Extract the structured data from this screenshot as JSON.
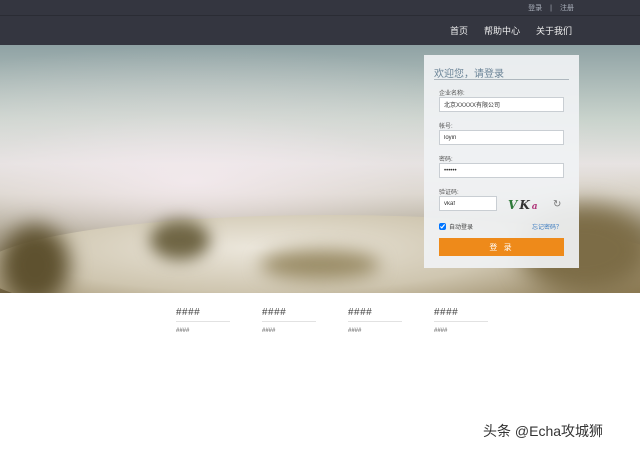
{
  "header": {
    "top_links": [
      "登录",
      "注册"
    ],
    "top_separator": "|",
    "nav": [
      "首页",
      "帮助中心",
      "关于我们"
    ]
  },
  "login": {
    "title": "欢迎您，请登录",
    "company_label": "企业名称:",
    "company_value": "北京XXXXX有限公司",
    "account_label": "帐号:",
    "account_value": "loyin",
    "password_label": "密码:",
    "password_value": "••••••",
    "captcha_label": "验证码:",
    "captcha_value": "vkaf",
    "captcha_chars": [
      "V",
      "K",
      "a"
    ],
    "remember_label": "自动登录",
    "remember_checked": true,
    "forgot_label": "忘记密码？",
    "submit_label": "登 录",
    "accent_color": "#ee8a1a",
    "refresh_icon": "refresh-icon"
  },
  "features": [
    {
      "title": "####",
      "text": "####"
    },
    {
      "title": "####",
      "text": "####"
    },
    {
      "title": "####",
      "text": "####"
    },
    {
      "title": "####",
      "text": "####"
    }
  ],
  "watermark": "头条 @Echa攻城狮"
}
